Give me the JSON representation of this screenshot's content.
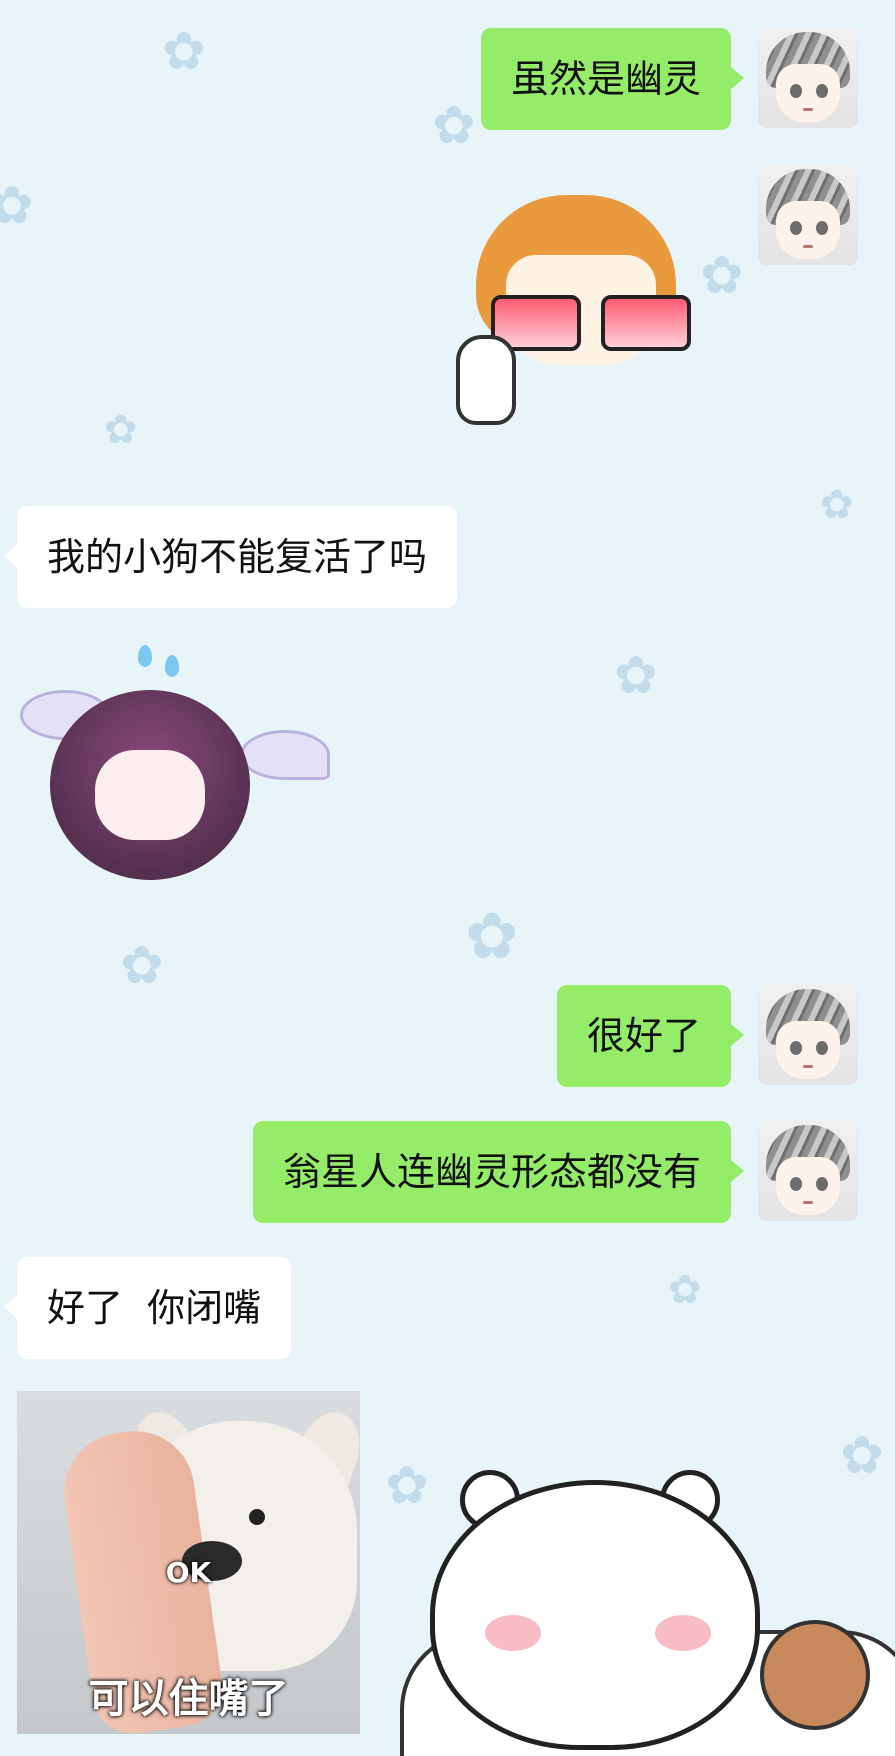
{
  "colors": {
    "background": "#e8f5f8",
    "sent_bubble": "#95ec69",
    "received_bubble": "#ffffff",
    "star": "#b9d6e6"
  },
  "messages": [
    {
      "side": "right",
      "type": "text",
      "text": "虽然是幽灵"
    },
    {
      "side": "right",
      "type": "sticker",
      "sticker": "orange-hair-glasses-character-sticker"
    },
    {
      "side": "left",
      "type": "text",
      "text": "我的小狗不能复活了吗"
    },
    {
      "side": "left",
      "type": "sticker",
      "sticker": "crying-purple-hair-character-sticker"
    },
    {
      "side": "right",
      "type": "text",
      "text": "很好了"
    },
    {
      "side": "right",
      "type": "text",
      "text": "翁星人连幽灵形态都没有"
    },
    {
      "side": "left",
      "type": "text",
      "text": "好了  你闭嘴"
    },
    {
      "side": "left",
      "type": "image",
      "meme": {
        "overlay": "OK",
        "caption": "可以住嘴了"
      }
    }
  ],
  "background_art": {
    "icons": [
      "star-icon",
      "white-bear-illustration",
      "small-brown-bear-illustration"
    ]
  }
}
